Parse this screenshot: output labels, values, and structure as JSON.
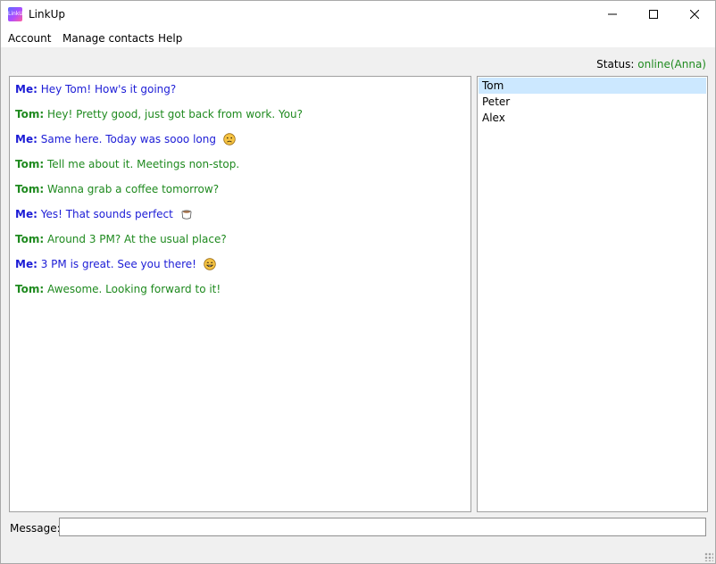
{
  "window": {
    "title": "LinkUp",
    "icon_text": "LinkUp"
  },
  "menu": [
    "Account",
    "Manage contacts",
    "Help"
  ],
  "status": {
    "label": "Status:",
    "value": "online(Anna)"
  },
  "colors": {
    "me": "#1c1cd6",
    "other": "#1f8a1f",
    "selected_contact_bg": "#cce8ff"
  },
  "messages": [
    {
      "sender": "Me:",
      "text": "Hey Tom! How's it going?",
      "from": "me",
      "emoji": ""
    },
    {
      "sender": "Tom:",
      "text": "Hey! Pretty good, just got back from work. You?",
      "from": "tom",
      "emoji": ""
    },
    {
      "sender": "Me:",
      "text": "Same here. Today was sooo long",
      "from": "me",
      "emoji": "sad-face-icon"
    },
    {
      "sender": "Tom:",
      "text": "Tell me about it. Meetings non-stop.",
      "from": "tom",
      "emoji": ""
    },
    {
      "sender": "Tom:",
      "text": "Wanna grab a coffee tomorrow?",
      "from": "tom",
      "emoji": ""
    },
    {
      "sender": "Me:",
      "text": "Yes! That sounds perfect",
      "from": "me",
      "emoji": "coffee-icon"
    },
    {
      "sender": "Tom:",
      "text": "Around 3 PM? At the usual place?",
      "from": "tom",
      "emoji": ""
    },
    {
      "sender": "Me:",
      "text": "3 PM is great. See you there!",
      "from": "me",
      "emoji": "smile-face-icon"
    },
    {
      "sender": "Tom:",
      "text": "Awesome. Looking forward to it!",
      "from": "tom",
      "emoji": ""
    }
  ],
  "contacts": [
    {
      "name": "Tom",
      "selected": true
    },
    {
      "name": "Peter",
      "selected": false
    },
    {
      "name": "Alex",
      "selected": false
    }
  ],
  "message_input": {
    "label": "Message:",
    "value": "",
    "placeholder": ""
  }
}
